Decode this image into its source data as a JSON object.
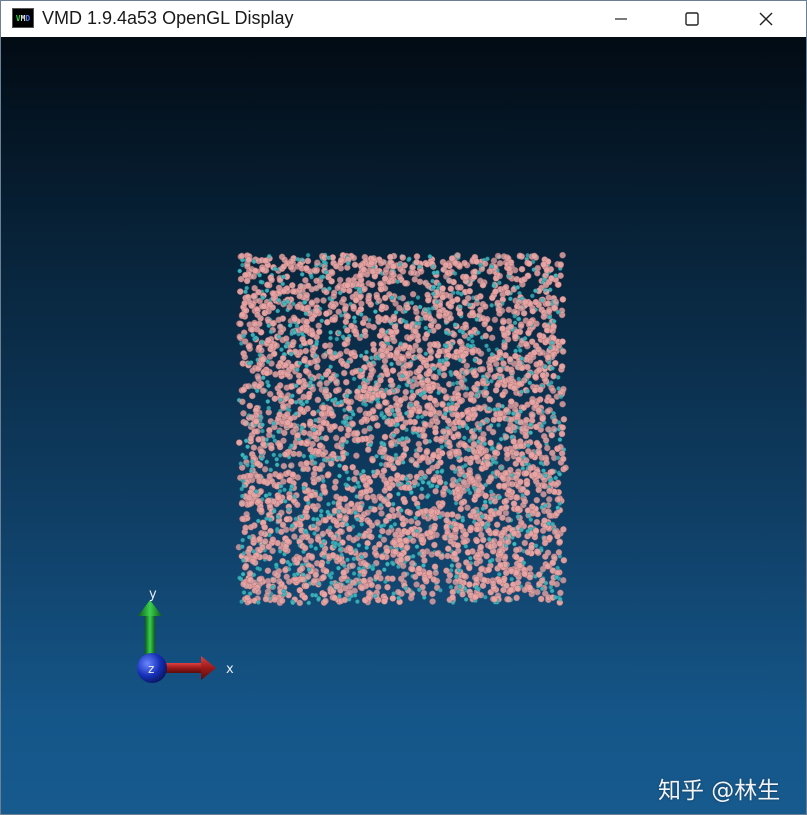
{
  "window": {
    "title": "VMD 1.9.4a53 OpenGL Display",
    "app_icon": "vmd-icon"
  },
  "controls": {
    "minimize_icon": "minimize-icon",
    "maximize_icon": "maximize-icon",
    "close_icon": "close-icon"
  },
  "scene": {
    "description_colors": {
      "background_top": "#020b14",
      "background_bottom": "#175a8e",
      "oxygen": "#e8a6a6",
      "hydrogen_carbon": "#3fb8c0"
    }
  },
  "axes": {
    "x_label": "x",
    "y_label": "y",
    "z_label": "z",
    "x_color": "#b51f1f",
    "y_color": "#1f9a2e",
    "z_color": "#1532b8"
  },
  "watermark": {
    "text": "知乎 @林生"
  }
}
